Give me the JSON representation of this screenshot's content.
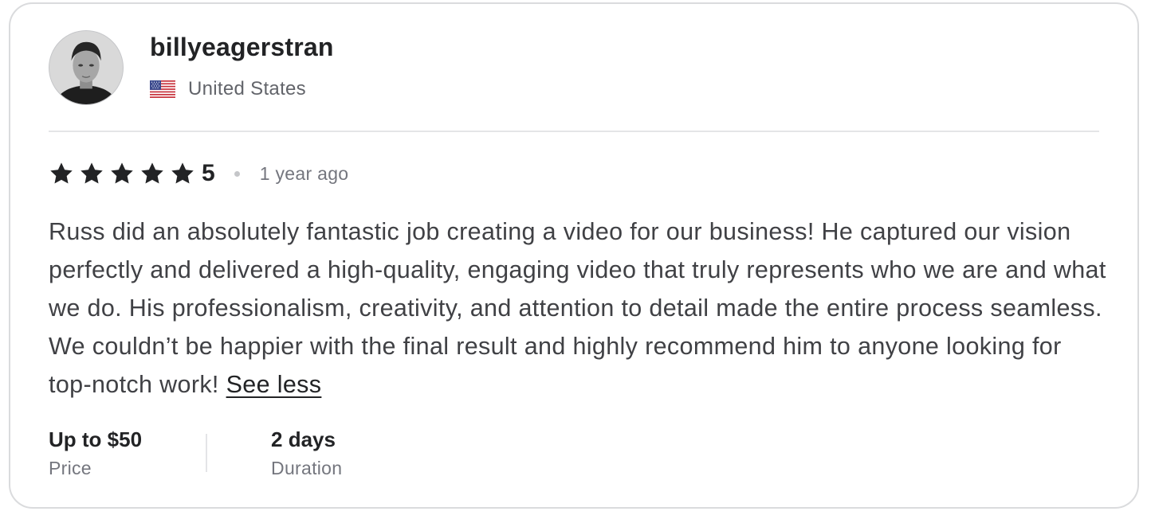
{
  "reviewer": {
    "username": "billyeagerstran",
    "country": "United States",
    "flag_icon": "us-flag-icon",
    "avatar_icon": "avatar-photo"
  },
  "rating": {
    "stars": 5,
    "score_label": "5",
    "time_ago": "1 year ago",
    "star_color": "#222325"
  },
  "review": {
    "text": "Russ did an absolutely fantastic job creating a video for our business! He captured our vision perfectly and delivered a high-quality, engaging video that truly represents who we are and what we do. His professionalism, creativity, and attention to detail made the entire process seamless. We couldn’t be happier with the final result and highly recommend him to anyone looking for top-notch work!",
    "see_less_label": "See less"
  },
  "details": {
    "price": {
      "value": "Up to $50",
      "label": "Price"
    },
    "duration": {
      "value": "2 days",
      "label": "Duration"
    }
  }
}
